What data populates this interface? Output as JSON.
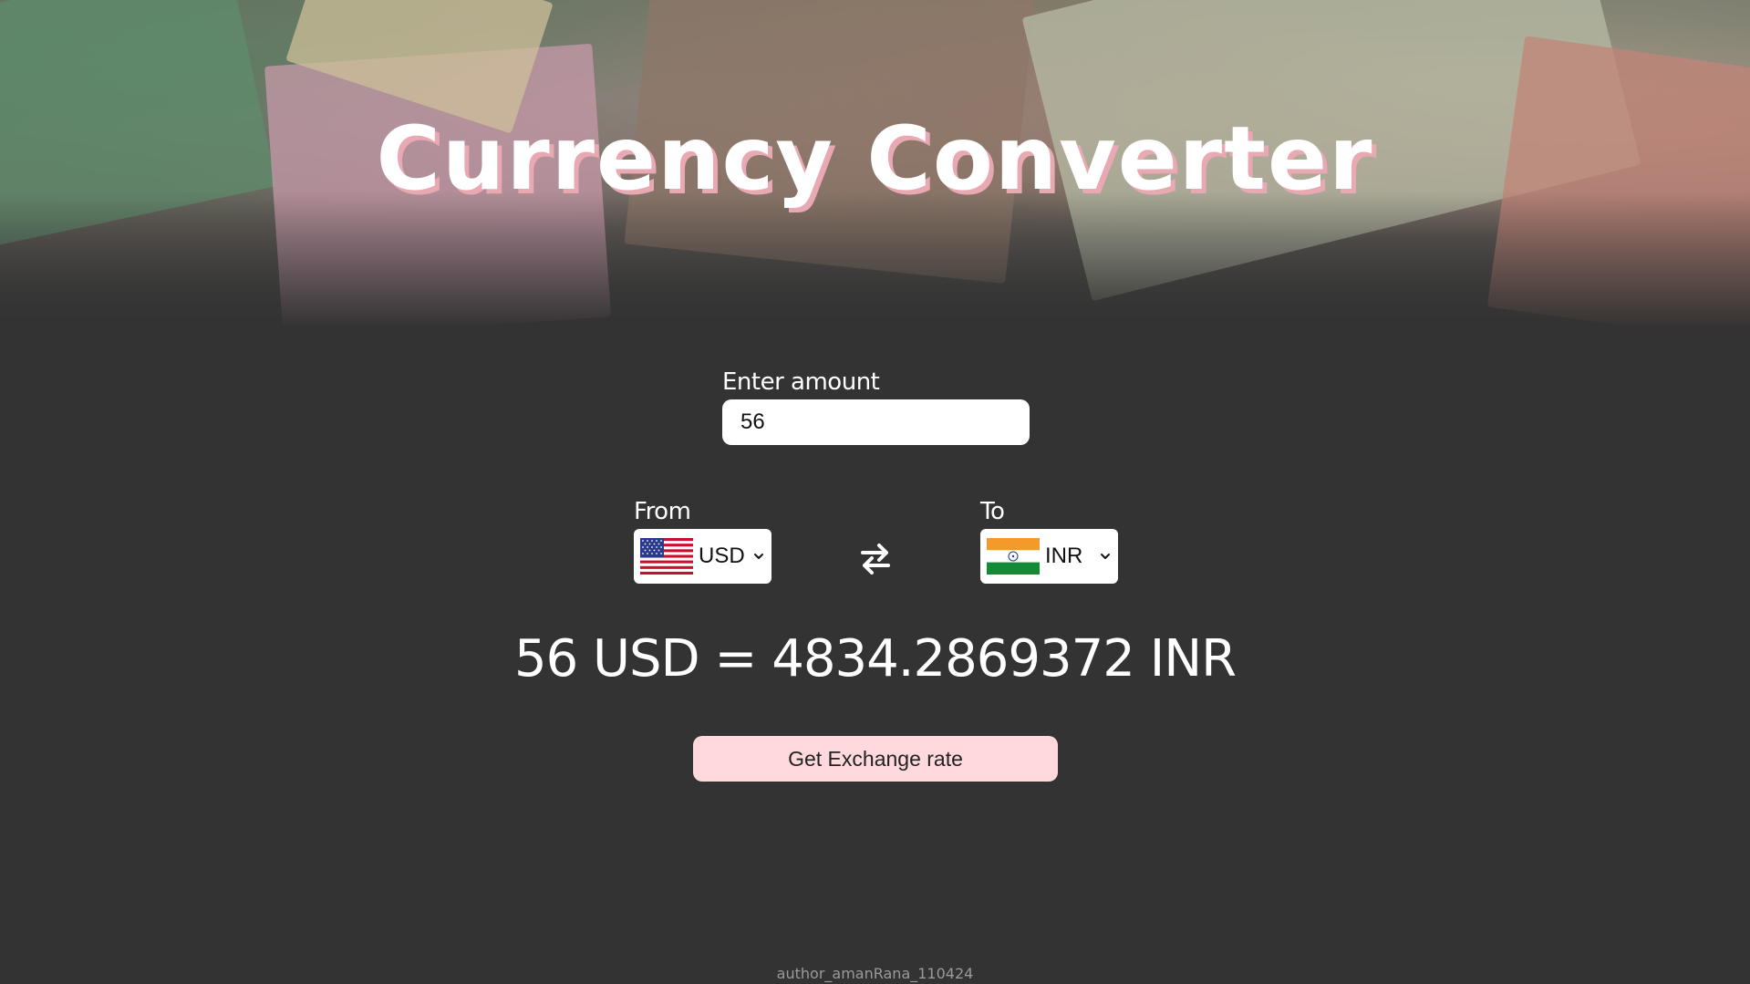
{
  "header": {
    "title": "Currency Converter"
  },
  "amount": {
    "label": "Enter amount",
    "value": "56"
  },
  "from": {
    "label": "From",
    "currency": "USD",
    "flag_icon": "us-flag-icon"
  },
  "to": {
    "label": "To",
    "currency": "INR",
    "flag_icon": "india-flag-icon"
  },
  "swap_icon": "swap-arrows-icon",
  "result": {
    "text": "56 USD = 4834.2869372 INR"
  },
  "button": {
    "label": "Get Exchange rate"
  },
  "footer": {
    "text": "author_amanRana_110424"
  },
  "colors": {
    "background": "#333333",
    "title_shadow": "#e9a9b3",
    "button_bg": "#ffd9dc"
  }
}
